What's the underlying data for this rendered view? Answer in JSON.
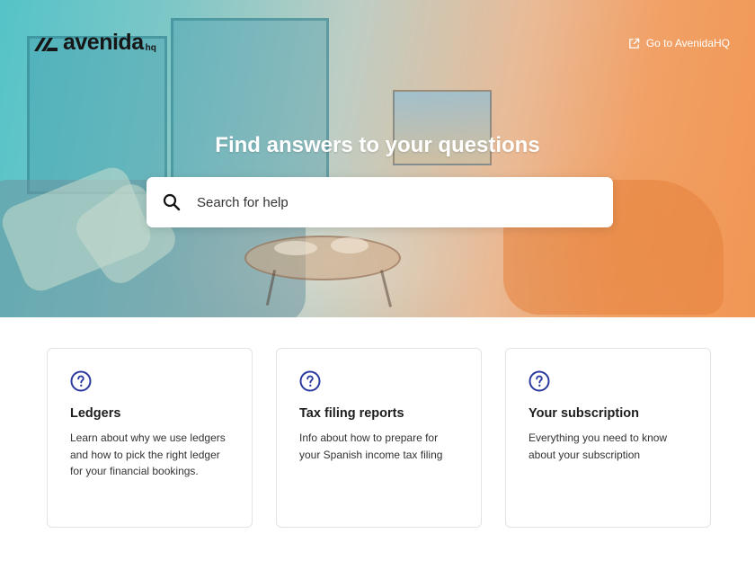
{
  "brand": {
    "name": "avenida",
    "suffix": "hq"
  },
  "header": {
    "external_link_label": "Go to AvenidaHQ",
    "external_link_icon": "external-link-icon"
  },
  "hero": {
    "title": "Find answers to your questions",
    "search": {
      "placeholder": "Search for help",
      "value": "",
      "icon": "search-icon"
    }
  },
  "categories": [
    {
      "icon": "question-circle-icon",
      "title": "Ledgers",
      "description": "Learn about why we use ledgers and how to pick the right ledger for your financial bookings."
    },
    {
      "icon": "question-circle-icon",
      "title": "Tax filing reports",
      "description": "Info about how to prepare for your Spanish income tax filing"
    },
    {
      "icon": "question-circle-icon",
      "title": "Your subscription",
      "description": "Everything you need to know about your subscription"
    }
  ],
  "colors": {
    "accent": "#2b3a9e",
    "hero_teal": "#46bec3",
    "hero_orange": "#f0914b"
  }
}
